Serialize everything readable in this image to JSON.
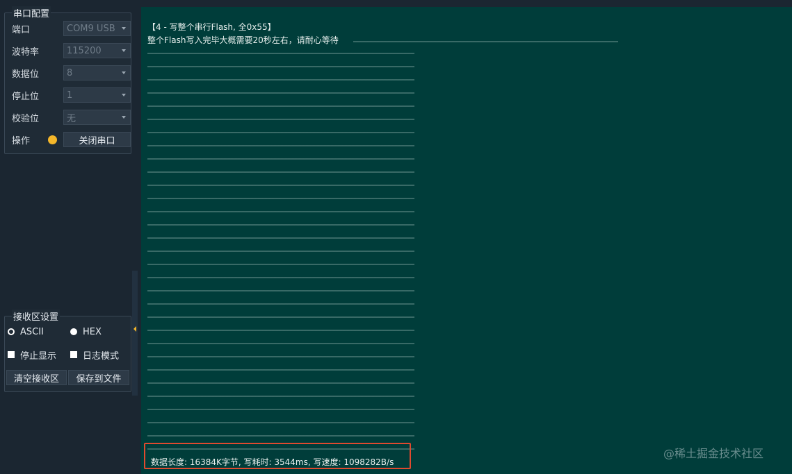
{
  "serial_config": {
    "title": "串口配置",
    "port_label": "端口",
    "port_value": "COM9 USB",
    "baud_label": "波特率",
    "baud_value": "115200",
    "databits_label": "数据位",
    "databits_value": "8",
    "stopbits_label": "停止位",
    "stopbits_value": "1",
    "parity_label": "校验位",
    "parity_value": "无",
    "operation_label": "操作",
    "close_port_label": "关闭串口",
    "indicator_color": "#f5b72a"
  },
  "rx_settings": {
    "title": "接收区设置",
    "ascii_label": "ASCII",
    "hex_label": "HEX",
    "selected_mode": "HEX",
    "stop_display_label": "停止显示",
    "stop_display_checked": true,
    "log_mode_label": "日志模式",
    "log_mode_checked": true,
    "clear_label": "清空接收区",
    "save_label": "保存到文件"
  },
  "terminal": {
    "background": "#003d3a",
    "header_line": "【4 - 写整个串行Flash, 全0x55】",
    "info_line": "整个Flash写入完毕大概需要20秒左右，请耐心等待",
    "progress_rows": 31,
    "stats_line": "数据长度: 16384K字节, 写耗时: 3544ms, 写速度: 1098282B/s"
  },
  "highlight_color": "#e04a2f",
  "watermark": "@稀土掘金技术社区"
}
